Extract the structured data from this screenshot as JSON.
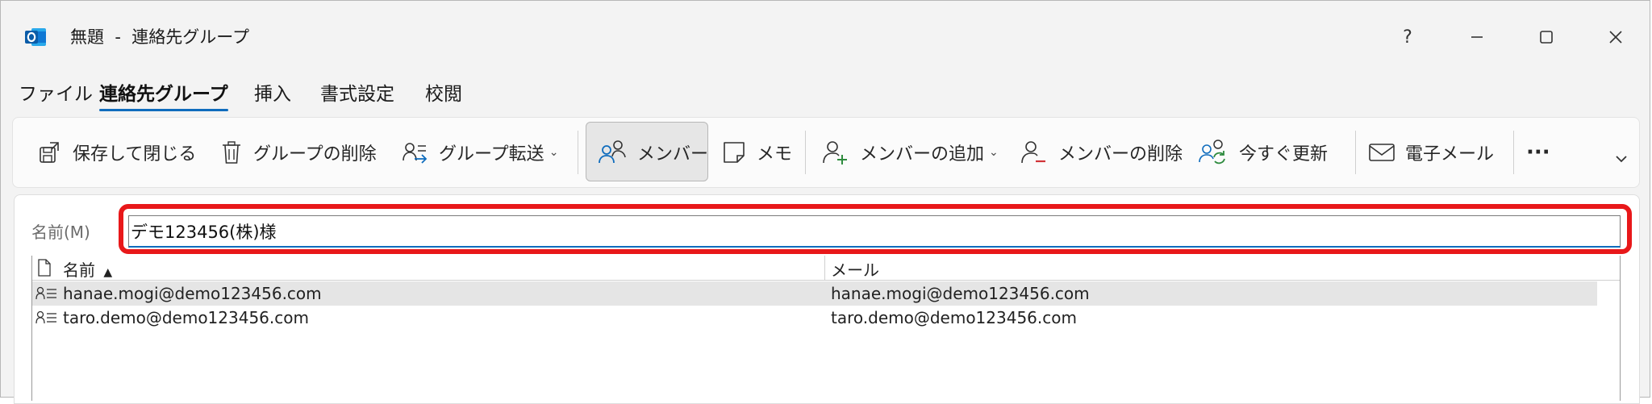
{
  "window": {
    "title": "無題  -  連絡先グループ",
    "help": "?"
  },
  "tabs": [
    {
      "label": "ファイル"
    },
    {
      "label": "連絡先グループ"
    },
    {
      "label": "挿入"
    },
    {
      "label": "書式設定"
    },
    {
      "label": "校閲"
    }
  ],
  "ribbon": {
    "save_close": "保存して閉じる",
    "delete_group": "グループの削除",
    "forward_group": "グループ転送",
    "members": "メンバー",
    "memo": "メモ",
    "add_member": "メンバーの追加",
    "remove_member": "メンバーの削除",
    "update_now": "今すぐ更新",
    "email": "電子メール",
    "more": "···"
  },
  "form": {
    "name_label": "名前(M)",
    "name_value": "デモ123456(株)様"
  },
  "list": {
    "col_name": "名前",
    "col_mail": "メール",
    "rows": [
      {
        "name": "hanae.mogi@demo123456.com",
        "mail": "hanae.mogi@demo123456.com"
      },
      {
        "name": "taro.demo@demo123456.com",
        "mail": "taro.demo@demo123456.com"
      }
    ]
  },
  "colors": {
    "accent": "#0f6cbd",
    "highlight": "#e8181a"
  }
}
